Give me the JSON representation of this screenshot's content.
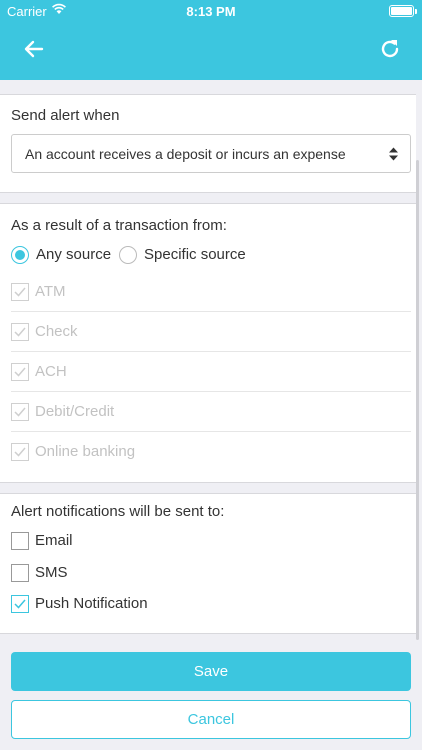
{
  "status_bar": {
    "carrier": "Carrier",
    "time": "8:13 PM"
  },
  "nav": {
    "back_icon": "arrow-left-icon",
    "refresh_icon": "refresh-icon",
    "color": "#3cc6df"
  },
  "alert": {
    "label": "Send alert when",
    "selected": "An account receives a deposit or incurs an expense"
  },
  "transaction": {
    "label": "As a result of a transaction from:",
    "radio_any": "Any source",
    "radio_specific": "Specific source",
    "sources": [
      {
        "label": "ATM",
        "checked": true
      },
      {
        "label": "Check",
        "checked": true
      },
      {
        "label": "ACH",
        "checked": true
      },
      {
        "label": "Debit/Credit",
        "checked": true
      },
      {
        "label": "Online banking",
        "checked": true
      }
    ]
  },
  "notifications": {
    "label": "Alert notifications will be sent to:",
    "options": [
      {
        "label": "Email",
        "checked": false
      },
      {
        "label": "SMS",
        "checked": false
      },
      {
        "label": "Push Notification",
        "checked": true
      }
    ]
  },
  "buttons": {
    "save": "Save",
    "cancel": "Cancel"
  }
}
